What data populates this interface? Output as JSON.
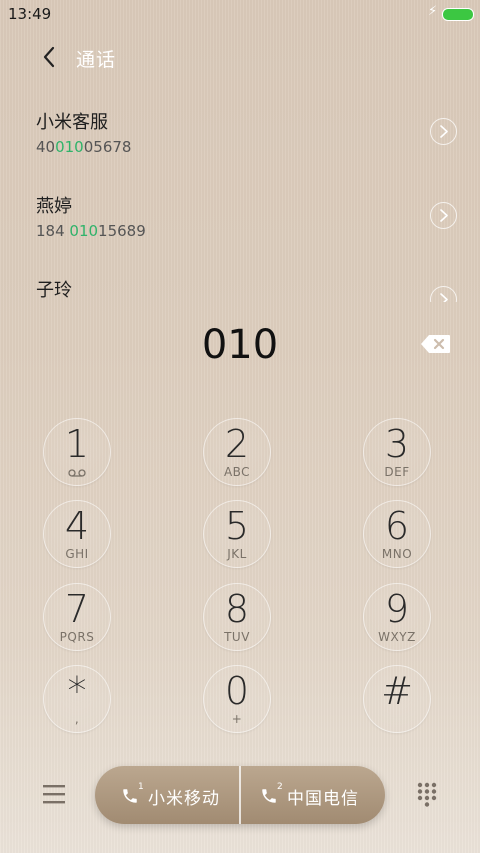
{
  "status": {
    "time": "13:49",
    "battery_color": "#3cc742"
  },
  "header": {
    "title": "通话"
  },
  "contacts": [
    {
      "name": "小米客服",
      "num_pre": "40",
      "num_hl": "010",
      "num_post": "05678"
    },
    {
      "name": "燕婷",
      "num_pre": "184 ",
      "num_hl": "010",
      "num_post": "15689"
    },
    {
      "name": "子玲",
      "num_pre": "",
      "num_hl": "",
      "num_post": ""
    }
  ],
  "highlight_color": "#2fb36a",
  "display": {
    "digits": "010"
  },
  "keypad": [
    {
      "num": "1",
      "sub": "",
      "icon": "voicemail-icon"
    },
    {
      "num": "2",
      "sub": "ABC"
    },
    {
      "num": "3",
      "sub": "DEF"
    },
    {
      "num": "4",
      "sub": "GHI"
    },
    {
      "num": "5",
      "sub": "JKL"
    },
    {
      "num": "6",
      "sub": "MNO"
    },
    {
      "num": "7",
      "sub": "PQRS"
    },
    {
      "num": "8",
      "sub": "TUV"
    },
    {
      "num": "9",
      "sub": "WXYZ"
    },
    {
      "num": "*",
      "sub": ","
    },
    {
      "num": "0",
      "sub": "+"
    },
    {
      "num": "#",
      "sub": ""
    }
  ],
  "call": {
    "sim1": {
      "label": "小米移动",
      "sim": "1"
    },
    "sim2": {
      "label": "中国电信",
      "sim": "2"
    }
  }
}
